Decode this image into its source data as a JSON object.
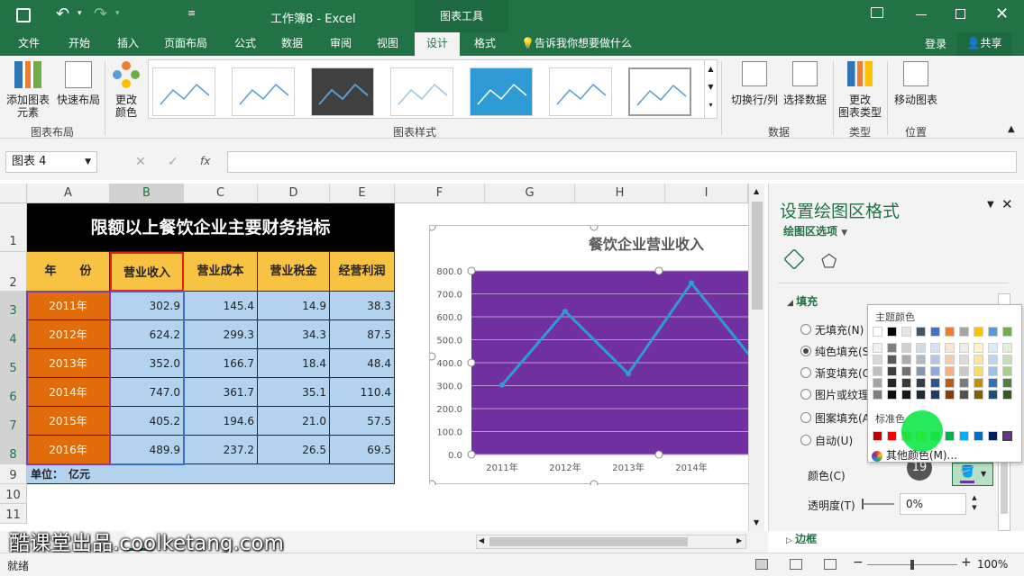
{
  "titlebar": {
    "title": "工作簿8 - Excel",
    "context_tool": "图表工具"
  },
  "tabs": [
    "文件",
    "开始",
    "插入",
    "页面布局",
    "公式",
    "数据",
    "审阅",
    "视图",
    "设计",
    "格式"
  ],
  "tell_me": "告诉我你想要做什么",
  "login": "登录",
  "share": "共享",
  "ribbon": {
    "add_element_1": "添加图表",
    "add_element_2": "元素",
    "quick_layout": "快速布局",
    "change_color_1": "更改",
    "change_color_2": "颜色",
    "group_layout": "图表布局",
    "group_styles": "图表样式",
    "switch_rowcol": "切换行/列",
    "select_data": "选择数据",
    "group_data": "数据",
    "change_type_1": "更改",
    "change_type_2": "图表类型",
    "group_type": "类型",
    "move_chart": "移动图表",
    "group_location": "位置"
  },
  "formula_bar": {
    "name_box": "图表 4",
    "fx": "fx",
    "formula": ""
  },
  "columns": [
    "A",
    "B",
    "C",
    "D",
    "E",
    "F",
    "G",
    "H",
    "I"
  ],
  "rows": [
    "1",
    "2",
    "3",
    "4",
    "5",
    "6",
    "7",
    "8",
    "9",
    "10",
    "11"
  ],
  "table": {
    "title": "限额以上餐饮企业主要财务指标",
    "headers": [
      "年　　份",
      "营业收入",
      "营业成本",
      "营业税金",
      "经营利润"
    ],
    "data": [
      [
        "2011年",
        "302.9",
        "145.4",
        "14.9",
        "38.3"
      ],
      [
        "2012年",
        "624.2",
        "299.3",
        "34.3",
        "87.5"
      ],
      [
        "2013年",
        "352.0",
        "166.7",
        "18.4",
        "48.4"
      ],
      [
        "2014年",
        "747.0",
        "361.7",
        "35.1",
        "110.4"
      ],
      [
        "2015年",
        "405.2",
        "194.6",
        "21.0",
        "57.5"
      ],
      [
        "2016年",
        "489.9",
        "237.2",
        "26.5",
        "69.5"
      ]
    ],
    "unit": "单位：　亿元"
  },
  "chart_data": {
    "type": "line",
    "title": "餐饮企业营业收入",
    "categories": [
      "2011年",
      "2012年",
      "2013年",
      "2014年",
      "20"
    ],
    "values": [
      302.9,
      624.2,
      352.0,
      747.0,
      405.2
    ],
    "y_ticks": [
      "800.0",
      "700.0",
      "600.0",
      "500.0",
      "400.0",
      "300.0",
      "200.0",
      "100.0",
      "0.0"
    ],
    "ylim": [
      0,
      800
    ],
    "grid": true,
    "plot_area_color": "#7030a0",
    "line_color": "#2e9bd6"
  },
  "pane": {
    "title": "设置绘图区格式",
    "subtitle": "绘图区选项",
    "fill_section": "填充",
    "options": [
      "无填充(N)",
      "纯色填充(S)",
      "渐变填充(G)",
      "图片或纹理",
      "图案填充(A)",
      "自动(U)"
    ],
    "color_label": "颜色(C)",
    "transparency_label": "透明度(T)",
    "transparency_value": "0%",
    "border_section": "边框"
  },
  "palette": {
    "theme_title": "主题颜色",
    "standard_title": "标准色",
    "more_colors": "其他颜色(M)...",
    "badge": "19"
  },
  "watermark": "酷课堂出品.coolketang.com",
  "status": {
    "ready": "就绪",
    "zoom": "100%"
  }
}
